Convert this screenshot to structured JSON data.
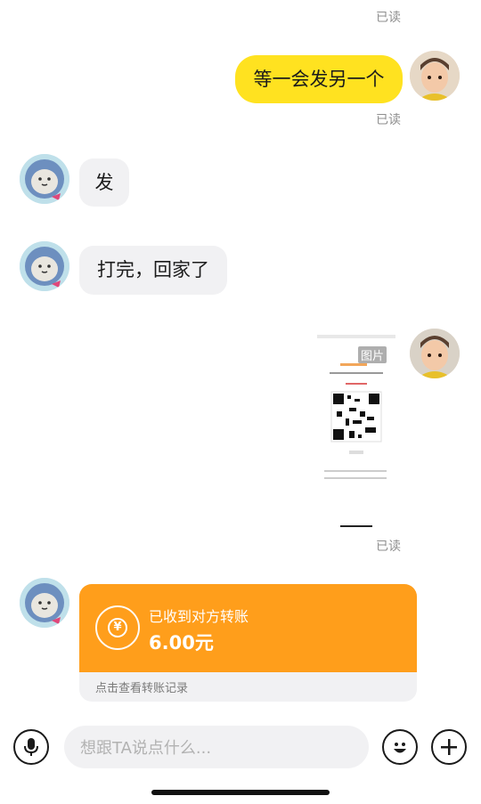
{
  "messages": {
    "m0_status": "已读",
    "m1_text": "等一会发另一个",
    "m1_status": "已读",
    "m2_text": "发",
    "m3_text": "打完，回家了",
    "m4_image_label": "图片",
    "m4_status": "已读",
    "m5_transfer_title": "已收到对方转账",
    "m5_transfer_amount": "6.00元",
    "m5_transfer_footer": "点击查看转账记录"
  },
  "input": {
    "placeholder": "想跟TA说点什么..."
  },
  "colors": {
    "my_bubble": "#ffe220",
    "their_bubble": "#f1f1f3",
    "transfer_card": "#ff9e1b",
    "read_status": "#8e8e8e"
  },
  "icons": [
    "voice-icon",
    "emoji-icon",
    "plus-icon",
    "yuan-icon"
  ]
}
